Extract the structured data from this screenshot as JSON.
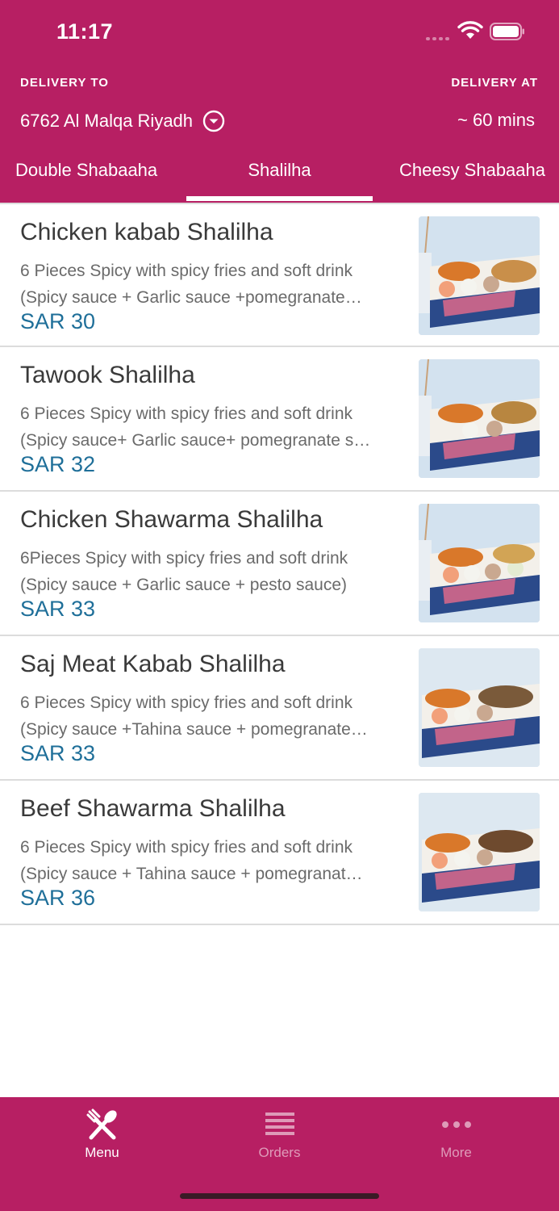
{
  "status_bar": {
    "time": "11:17"
  },
  "header": {
    "delivery_to_label": "DELIVERY TO",
    "delivery_at_label": "DELIVERY AT",
    "address": "6762 Al Malqa Riyadh",
    "eta": "~ 60 mins",
    "brand_color": "#b71f63"
  },
  "tabs": [
    {
      "label": "Double Shabaaha"
    },
    {
      "label": "Shalilha",
      "selected": true
    },
    {
      "label": "Cheesy Shabaaha"
    }
  ],
  "menu_items": [
    {
      "name": "Chicken kabab  Shalilha",
      "desc_line1": "6 Pieces Spicy with spicy fries  and soft drink",
      "desc_line2": "(Spicy sauce + Garlic sauce +pomegranate…",
      "price": "SAR 30"
    },
    {
      "name": "Tawook Shalilha",
      "desc_line1": "6 Pieces Spicy with spicy fries  and soft drink",
      "desc_line2": "(Spicy sauce+ Garlic sauce+ pomegranate s…",
      "price": "SAR 32"
    },
    {
      "name": "Chicken Shawarma Shalilha",
      "desc_line1": "6Pieces Spicy with spicy fries  and soft drink",
      "desc_line2": "(Spicy sauce + Garlic sauce + pesto sauce)",
      "price": "SAR 33"
    },
    {
      "name": "Saj Meat Kabab Shalilha",
      "desc_line1": "6 Pieces Spicy with spicy fries  and soft drink",
      "desc_line2": "(Spicy sauce +Tahina sauce + pomegranate…",
      "price": "SAR 33"
    },
    {
      "name": "Beef Shawarma Shalilha",
      "desc_line1": "6 Pieces Spicy with spicy fries  and soft drink",
      "desc_line2": "(Spicy sauce + Tahina sauce + pomegranat…",
      "price": "SAR 36"
    }
  ],
  "bottom_nav": {
    "menu_label": "Menu",
    "orders_label": "Orders",
    "more_label": "More",
    "active": "Menu"
  }
}
